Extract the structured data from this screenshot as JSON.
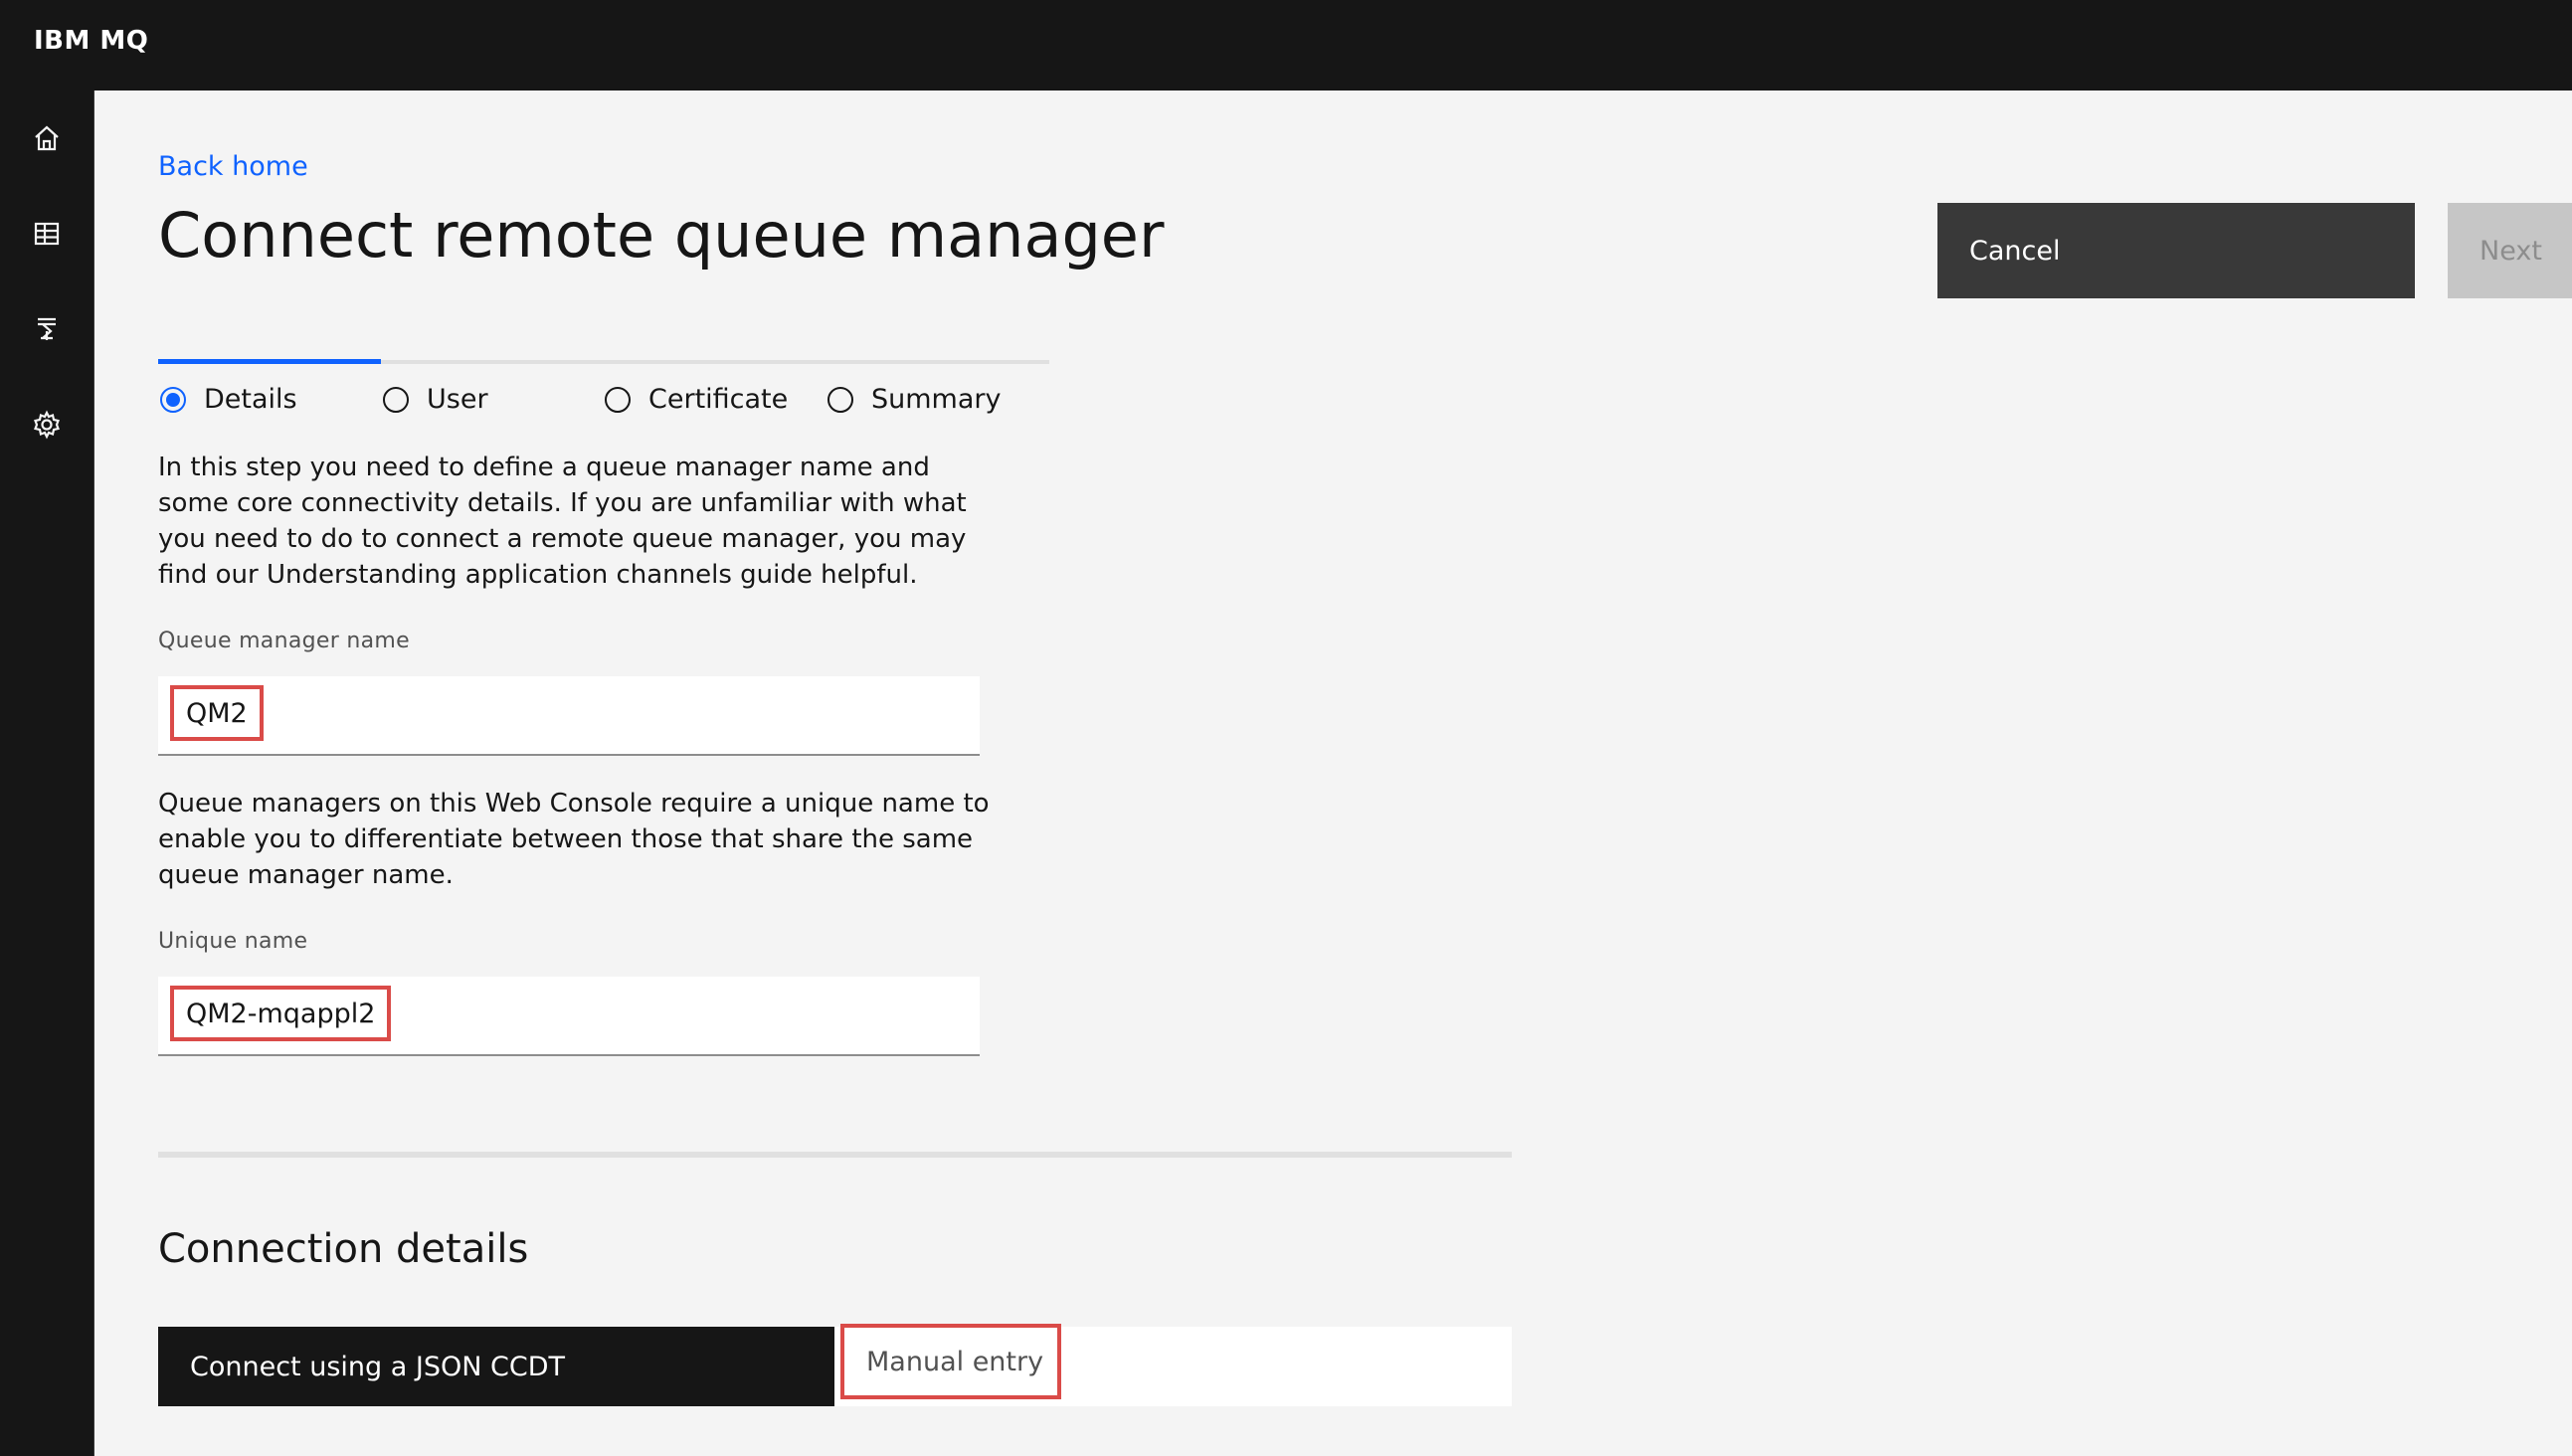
{
  "app": {
    "brand": "IBM MQ"
  },
  "sidebar": {
    "items": [
      {
        "icon": "home-icon"
      },
      {
        "icon": "table-icon"
      },
      {
        "icon": "queue-manager-icon"
      },
      {
        "icon": "gear-icon"
      }
    ]
  },
  "header": {
    "back_link": "Back home",
    "title": "Connect remote queue manager",
    "cancel_label": "Cancel",
    "next_label": "Next"
  },
  "steps": [
    {
      "label": "Details",
      "active": true
    },
    {
      "label": "User",
      "active": false
    },
    {
      "label": "Certificate",
      "active": false
    },
    {
      "label": "Summary",
      "active": false
    }
  ],
  "details": {
    "intro": "In this step you need to define a queue manager name and some core connectivity details. If you are unfamiliar with what you need to do to connect a remote queue manager, you may find our Understanding application channels guide helpful.",
    "qm_name_label": "Queue manager name",
    "qm_name_value": "QM2",
    "unique_help": "Queue managers on this Web Console require a unique name to enable you to differentiate between those that share the same queue manager name.",
    "unique_name_label": "Unique name",
    "unique_name_value": "QM2-mqappl2"
  },
  "connection": {
    "title": "Connection details",
    "option_json": "Connect using a JSON CCDT",
    "option_manual": "Manual entry"
  },
  "colors": {
    "accent": "#0f62fe",
    "highlight": "#da4b48",
    "dark": "#161616"
  }
}
